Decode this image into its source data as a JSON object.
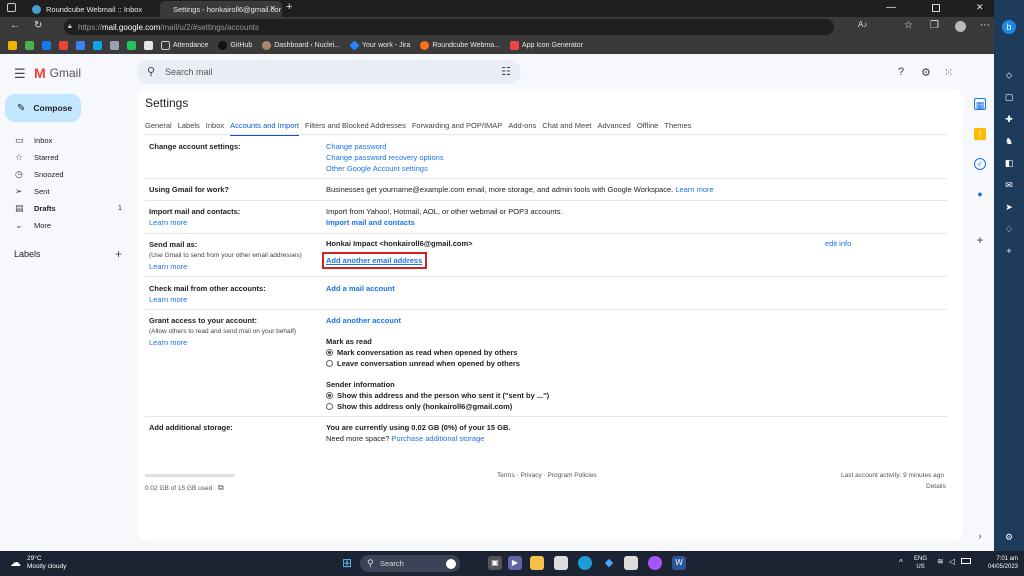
{
  "browser": {
    "tabs": [
      {
        "title": "Roundcube Webmail :: Inbox",
        "active": false
      },
      {
        "title": "Settings - honkairoll6@gmail.cor",
        "active": true
      }
    ],
    "url_prefix": "https://",
    "url_main": "mail.google.com",
    "url_rest": "/mail/u/2/#settings/accounts",
    "bookmarks": [
      "Attendance",
      "GitHub",
      "Dashboard ‹ Nuclei...",
      "Your work - Jira",
      "Roundcube Webma...",
      "App Icon Generator"
    ]
  },
  "gmail": {
    "app_name": "Gmail",
    "search_placeholder": "Search mail",
    "avatar_letter": "H",
    "compose_label": "Compose",
    "nav": [
      {
        "label": "Inbox",
        "icon": "inbox-icon",
        "count": ""
      },
      {
        "label": "Starred",
        "icon": "star-icon",
        "count": ""
      },
      {
        "label": "Snoozed",
        "icon": "clock-icon",
        "count": ""
      },
      {
        "label": "Sent",
        "icon": "send-icon",
        "count": ""
      },
      {
        "label": "Drafts",
        "icon": "draft-icon",
        "count": "1"
      },
      {
        "label": "More",
        "icon": "chevron-down-icon",
        "count": ""
      }
    ],
    "labels_heading": "Labels"
  },
  "settings": {
    "title": "Settings",
    "tabs": [
      "General",
      "Labels",
      "Inbox",
      "Accounts and Import",
      "Filters and Blocked Addresses",
      "Forwarding and POP/IMAP",
      "Add-ons",
      "Chat and Meet",
      "Advanced",
      "Offline",
      "Themes"
    ],
    "active_tab": "Accounts and Import",
    "change_account": {
      "label": "Change account settings:",
      "links": [
        "Change password",
        "Change password recovery options",
        "Other Google Account settings"
      ]
    },
    "using_for_work": {
      "label": "Using Gmail for work?",
      "text": "Businesses get yourname@example.com email, more storage, and admin tools with Google Workspace.",
      "link": "Learn more"
    },
    "import": {
      "label": "Import mail and contacts:",
      "learn_more": "Learn more",
      "text": "Import from Yahoo!, Hotmail, AOL, or other webmail or POP3 accounts.",
      "action": "Import mail and contacts"
    },
    "send_as": {
      "label": "Send mail as:",
      "sub": "(Use Gmail to send from your other email addresses)",
      "learn_more": "Learn more",
      "identity": "Honkai Impact <honkairoll6@gmail.com>",
      "edit": "edit info",
      "add": "Add another email address"
    },
    "check_mail": {
      "label": "Check mail from other accounts:",
      "learn_more": "Learn more",
      "action": "Add a mail account"
    },
    "grant": {
      "label": "Grant access to your account:",
      "sub": "(Allow others to read and send mail on your behalf)",
      "learn_more": "Learn more",
      "action": "Add another account",
      "mark_heading": "Mark as read",
      "mark_options": [
        "Mark conversation as read when opened by others",
        "Leave conversation unread when opened by others"
      ],
      "mark_selected": 0,
      "sender_heading": "Sender information",
      "sender_options": [
        "Show this address and the person who sent it (\"sent by ...\")",
        "Show this address only (honkairoll6@gmail.com)"
      ],
      "sender_selected": 0
    },
    "storage": {
      "label": "Add additional storage:",
      "usage": "You are currently using 0.02 GB (0%) of your 15 GB.",
      "need_more": "Need more space?",
      "purchase": "Purchase additional storage"
    },
    "footer": {
      "storage_text": "0.02 GB of 15 GB used",
      "storage_fraction": 0.0,
      "terms": "Terms · Privacy · Program Policies",
      "activity": "Last account activity: 9 minutes ago",
      "details": "Details"
    }
  },
  "taskbar": {
    "weather_temp": "29°C",
    "weather_desc": "Mostly cloudy",
    "search": "Search",
    "lang": "ENG",
    "region": "US",
    "time": "7:01 am",
    "date": "04/05/2023"
  }
}
